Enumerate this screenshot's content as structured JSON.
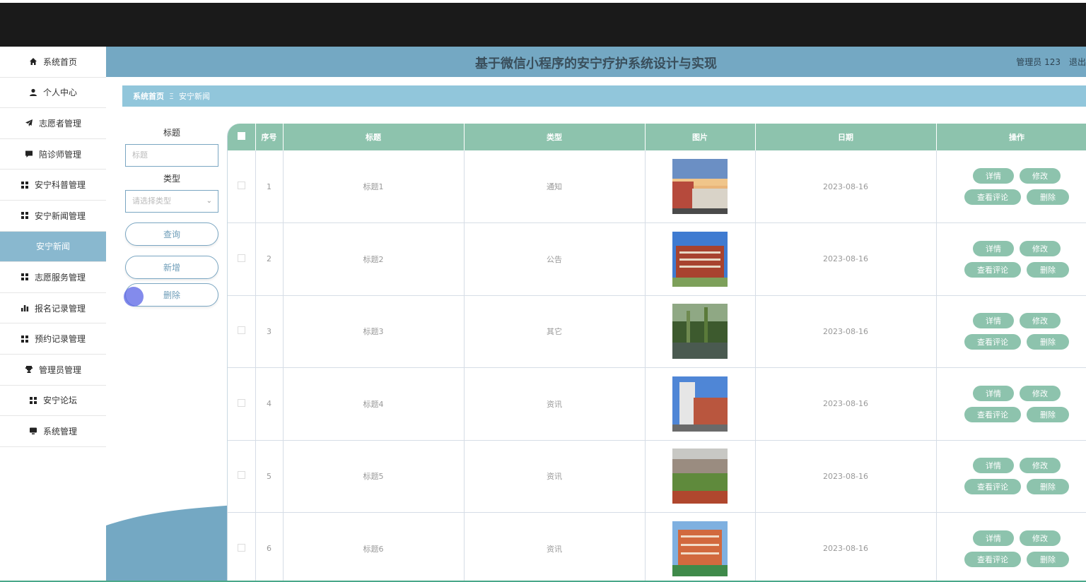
{
  "sidebar": {
    "items": [
      {
        "label": "系统首页",
        "icon": "home-icon"
      },
      {
        "label": "个人中心",
        "icon": "user-icon"
      },
      {
        "label": "志愿者管理",
        "icon": "send-icon"
      },
      {
        "label": "陪诊师管理",
        "icon": "chat-icon"
      },
      {
        "label": "安宁科普管理",
        "icon": "grid-icon"
      },
      {
        "label": "安宁新闻管理",
        "icon": "grid-icon"
      },
      {
        "label": "安宁新闻",
        "icon": "",
        "active": true
      },
      {
        "label": "志愿服务管理",
        "icon": "grid-icon"
      },
      {
        "label": "报名记录管理",
        "icon": "bar-chart-icon"
      },
      {
        "label": "预约记录管理",
        "icon": "grid-icon"
      },
      {
        "label": "管理员管理",
        "icon": "trophy-icon"
      },
      {
        "label": "安宁论坛",
        "icon": "grid-icon"
      },
      {
        "label": "系统管理",
        "icon": "monitor-icon"
      }
    ]
  },
  "header": {
    "title": "基于微信小程序的安宁疗护系统设计与实现",
    "user": "管理员 123",
    "logout": "退出"
  },
  "breadcrumb": {
    "home": "系统首页",
    "separator": "Ξ",
    "current": "安宁新闻"
  },
  "search": {
    "title_label": "标题",
    "title_placeholder": "标题",
    "type_label": "类型",
    "type_placeholder": "请选择类型",
    "query_button": "查询",
    "add_button": "新增",
    "delete_button": "删除"
  },
  "table": {
    "headers": {
      "index": "序号",
      "title": "标题",
      "type": "类型",
      "image": "图片",
      "date": "日期",
      "actions": "操作"
    },
    "actions": {
      "detail": "详情",
      "edit": "修改",
      "comments": "查看评论",
      "delete": "删除"
    },
    "rows": [
      {
        "index": "1",
        "title": "标题1",
        "type": "通知",
        "date": "2023-08-16"
      },
      {
        "index": "2",
        "title": "标题2",
        "type": "公告",
        "date": "2023-08-16"
      },
      {
        "index": "3",
        "title": "标题3",
        "type": "其它",
        "date": "2023-08-16"
      },
      {
        "index": "4",
        "title": "标题4",
        "type": "资讯",
        "date": "2023-08-16"
      },
      {
        "index": "5",
        "title": "标题5",
        "type": "资讯",
        "date": "2023-08-16"
      },
      {
        "index": "6",
        "title": "标题6",
        "type": "资讯",
        "date": "2023-08-16"
      }
    ]
  },
  "colors": {
    "accent_green": "#8dc3ad",
    "header_blue": "#74a8c3",
    "active_blue": "#89b8cf"
  }
}
